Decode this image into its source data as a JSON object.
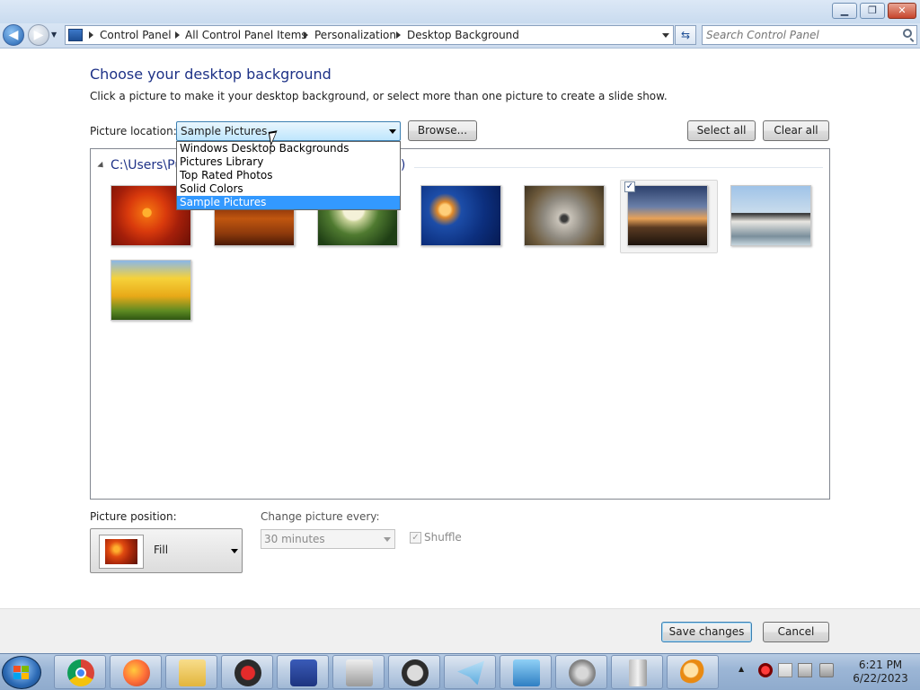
{
  "window": {
    "minimize_glyph": "▁",
    "maximize_glyph": "❐",
    "close_glyph": "✕"
  },
  "nav": {
    "back_glyph": "◀",
    "forward_glyph": "▶",
    "breadcrumbs": [
      "Control Panel",
      "All Control Panel Items",
      "Personalization",
      "Desktop Background"
    ],
    "refresh_glyph": "⇆",
    "search_placeholder": "Search Control Panel"
  },
  "main": {
    "title": "Choose your desktop background",
    "description": "Click a picture to make it your desktop background, or select more than one picture to create a slide show.",
    "picture_location_label": "Picture location:",
    "picture_location_value": "Sample Pictures",
    "browse_label": "Browse...",
    "select_all_label": "Select all",
    "clear_all_label": "Clear all",
    "group_prefix": "C:\\Users\\Pu",
    "group_suffix": "3)",
    "dropdown_options": [
      "Windows Desktop Backgrounds",
      "Pictures Library",
      "Top Rated Photos",
      "Solid Colors",
      "Sample Pictures"
    ],
    "selected_option": "Sample Pictures",
    "pictures": [
      {
        "name": "Chrysanthemum",
        "selected": false
      },
      {
        "name": "Desert",
        "selected": false
      },
      {
        "name": "Hydrangeas",
        "selected": false
      },
      {
        "name": "Jellyfish",
        "selected": false
      },
      {
        "name": "Koala",
        "selected": false
      },
      {
        "name": "Lighthouse",
        "selected": true
      },
      {
        "name": "Penguins",
        "selected": false
      },
      {
        "name": "Tulips",
        "selected": false
      }
    ],
    "checkmark": "✓",
    "picture_position_label": "Picture position:",
    "picture_position_value": "Fill",
    "change_picture_label": "Change picture every:",
    "change_picture_value": "30 minutes",
    "shuffle_label": "Shuffle",
    "shuffle_checked": true
  },
  "footer": {
    "save_label": "Save changes",
    "cancel_label": "Cancel"
  },
  "taskbar": {
    "apps": [
      "chrome",
      "firefox",
      "file-explorer",
      "security-app",
      "screen-tool",
      "printer",
      "lock-app",
      "telegram",
      "network-monitor",
      "speaker",
      "server-tool",
      "search-tool"
    ],
    "time": "6:21 PM",
    "date": "6/22/2023",
    "show_hidden_glyph": "▲"
  }
}
